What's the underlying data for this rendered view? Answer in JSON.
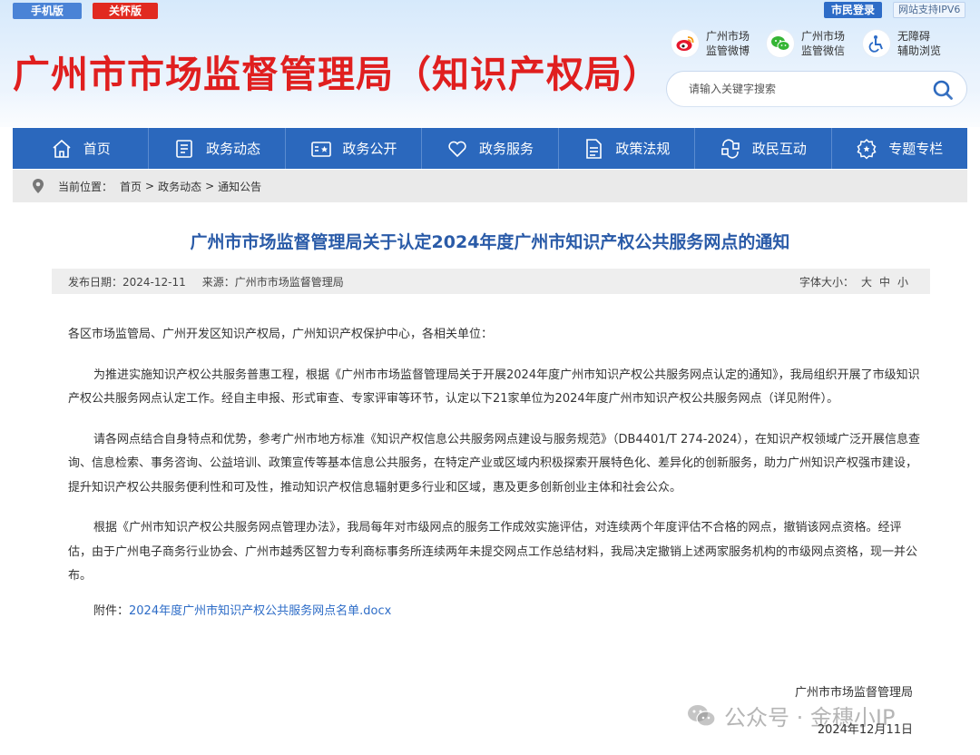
{
  "top": {
    "mobile_label": "手机版",
    "care_label": "关怀版",
    "login_label": "市民登录",
    "ipv6_label": "网站支持IPV6"
  },
  "site_title": "广州市市场监督管理局（知识产权局）",
  "social": [
    {
      "icon": "weibo-icon",
      "line1": "广州市场",
      "line2": "监管微博"
    },
    {
      "icon": "wechat-icon",
      "line1": "广州市场",
      "line2": "监管微信"
    },
    {
      "icon": "accessibility-icon",
      "line1": "无障碍",
      "line2": "辅助浏览"
    }
  ],
  "search": {
    "placeholder": "请输入关键字搜索"
  },
  "nav": [
    {
      "label": "首页",
      "icon": "home-icon"
    },
    {
      "label": "政务动态",
      "icon": "news-icon"
    },
    {
      "label": "政务公开",
      "icon": "open-gov-icon"
    },
    {
      "label": "政务服务",
      "icon": "heart-service-icon"
    },
    {
      "label": "政策法规",
      "icon": "document-icon"
    },
    {
      "label": "政民互动",
      "icon": "interaction-icon"
    },
    {
      "label": "专题专栏",
      "icon": "topic-gear-icon"
    }
  ],
  "breadcrumb": {
    "prefix": "当前位置：",
    "items": [
      "首页",
      "政务动态",
      "通知公告"
    ],
    "sep": ">"
  },
  "article": {
    "title": "广州市市场监督管理局关于认定2024年度广州市知识产权公共服务网点的通知",
    "date_label": "发布日期：",
    "date": "2024-12-11",
    "source_label": "来源：",
    "source": "广州市市场监督管理局",
    "font_size_label": "字体大小：",
    "font_sizes": [
      "大",
      "中",
      "小"
    ],
    "greeting": "各区市场监管局、广州开发区知识产权局，广州知识产权保护中心，各相关单位：",
    "paragraphs": [
      "为推进实施知识产权公共服务普惠工程，根据《广州市市场监督管理局关于开展2024年度广州市知识产权公共服务网点认定的通知》，我局组织开展了市级知识产权公共服务网点认定工作。经自主申报、形式审查、专家评审等环节，认定以下21家单位为2024年度广州市知识产权公共服务网点（详见附件）。",
      "请各网点结合自身特点和优势，参考广州市地方标准《知识产权信息公共服务网点建设与服务规范》（DB4401/T 274-2024），在知识产权领域广泛开展信息查询、信息检索、事务咨询、公益培训、政策宣传等基本信息公共服务，在特定产业或区域内积极探索开展特色化、差异化的创新服务，助力广州知识产权强市建设，提升知识产权公共服务便利性和可及性，推动知识产权信息辐射更多行业和区域，惠及更多创新创业主体和社会公众。",
      "根据《广州市知识产权公共服务网点管理办法》，我局每年对市级网点的服务工作成效实施评估，对连续两个年度评估不合格的网点，撤销该网点资格。经评估，由于广州电子商务行业协会、广州市越秀区智力专利商标事务所连续两年未提交网点工作总结材料，我局决定撤销上述两家服务机构的市级网点资格，现一并公布。"
    ],
    "attachment_label": "附件：",
    "attachment_name": "2024年度广州市知识产权公共服务网点名单.docx",
    "signature": "广州市市场监督管理局",
    "sign_date": "2024年12月11日"
  },
  "watermark": "公众号 · 金穗小IP",
  "colors": {
    "title_red": "#e01f1f",
    "nav_blue": "#2b68bd",
    "article_title_blue": "#2a5ba8",
    "link_blue": "#2d6cc7"
  }
}
